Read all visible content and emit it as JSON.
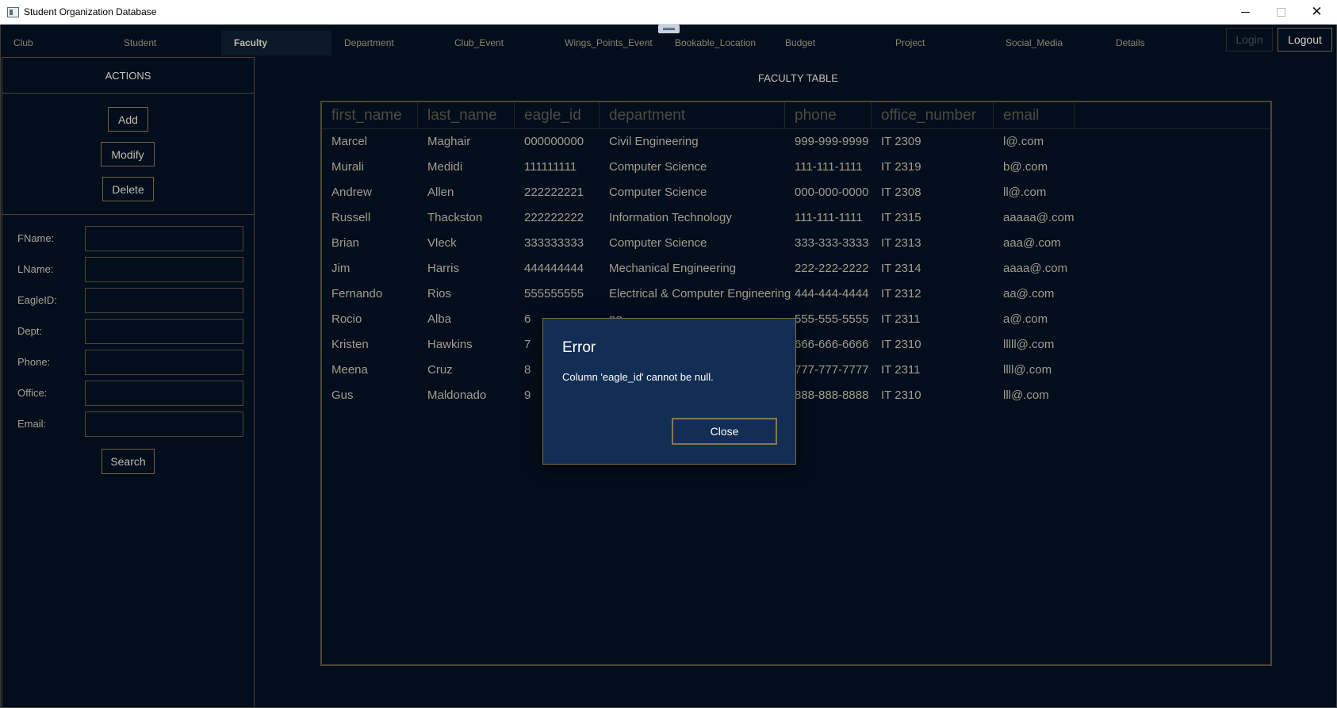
{
  "window": {
    "title": "Student Organization Database"
  },
  "tabs": [
    {
      "label": "Club",
      "active": false
    },
    {
      "label": "Student",
      "active": false
    },
    {
      "label": "Faculty",
      "active": true
    },
    {
      "label": "Department",
      "active": false
    },
    {
      "label": "Club_Event",
      "active": false
    },
    {
      "label": "Wings_Points_Event",
      "active": false
    },
    {
      "label": "Bookable_Location",
      "active": false
    },
    {
      "label": "Budget",
      "active": false
    },
    {
      "label": "Project",
      "active": false
    },
    {
      "label": "Social_Media",
      "active": false
    },
    {
      "label": "Details",
      "active": false
    }
  ],
  "auth": {
    "login": "Login",
    "logout": "Logout",
    "login_enabled": false
  },
  "sidebar": {
    "title": "ACTIONS",
    "buttons": {
      "add": "Add",
      "modify": "Modify",
      "delete": "Delete"
    },
    "fields": [
      {
        "label": "FName:",
        "value": ""
      },
      {
        "label": "LName:",
        "value": ""
      },
      {
        "label": "EagleID:",
        "value": ""
      },
      {
        "label": "Dept:",
        "value": ""
      },
      {
        "label": "Phone:",
        "value": ""
      },
      {
        "label": "Office:",
        "value": ""
      },
      {
        "label": "Email:",
        "value": ""
      }
    ],
    "search_button": "Search"
  },
  "table": {
    "title": "FACULTY TABLE",
    "columns": [
      "first_name",
      "last_name",
      "eagle_id",
      "department",
      "phone",
      "office_number",
      "email"
    ],
    "rows": [
      [
        "Marcel",
        "Maghair",
        "000000000",
        "Civil Engineering",
        "999-999-9999",
        "IT 2309",
        "l@.com"
      ],
      [
        "Murali",
        "Medidi",
        "111111111",
        "Computer Science",
        "111-111-1111",
        "IT 2319",
        "b@.com"
      ],
      [
        "Andrew",
        "Allen",
        "222222221",
        "Computer Science",
        "000-000-0000",
        "IT 2308",
        "ll@.com"
      ],
      [
        "Russell",
        "Thackston",
        "222222222",
        "Information Technology",
        "111-111-1111",
        "IT 2315",
        "aaaaa@.com"
      ],
      [
        "Brian",
        "Vleck",
        "333333333",
        "Computer Science",
        "333-333-3333",
        "IT 2313",
        "aaa@.com"
      ],
      [
        "Jim",
        "Harris",
        "444444444",
        "Mechanical Engineering",
        "222-222-2222",
        "IT 2314",
        "aaaa@.com"
      ],
      [
        "Fernando",
        "Rios",
        "555555555",
        "Electrical & Computer Engineering",
        "444-444-4444",
        "IT 2312",
        "aa@.com"
      ],
      [
        "Rocio",
        "Alba",
        "6",
        "ng",
        "555-555-5555",
        "IT 2311",
        "a@.com"
      ],
      [
        "Kristen",
        "Hawkins",
        "7",
        "",
        "666-666-6666",
        "IT 2310",
        "lllll@.com"
      ],
      [
        "Meena",
        "Cruz",
        "8",
        "",
        "777-777-7777",
        "IT 2311",
        "llll@.com"
      ],
      [
        "Gus",
        "Maldonado",
        "9",
        "",
        "888-888-8888",
        "IT 2310",
        "lll@.com"
      ]
    ]
  },
  "dialog": {
    "title": "Error",
    "message": "Column 'eagle_id' cannot be null.",
    "close_button": "Close"
  }
}
